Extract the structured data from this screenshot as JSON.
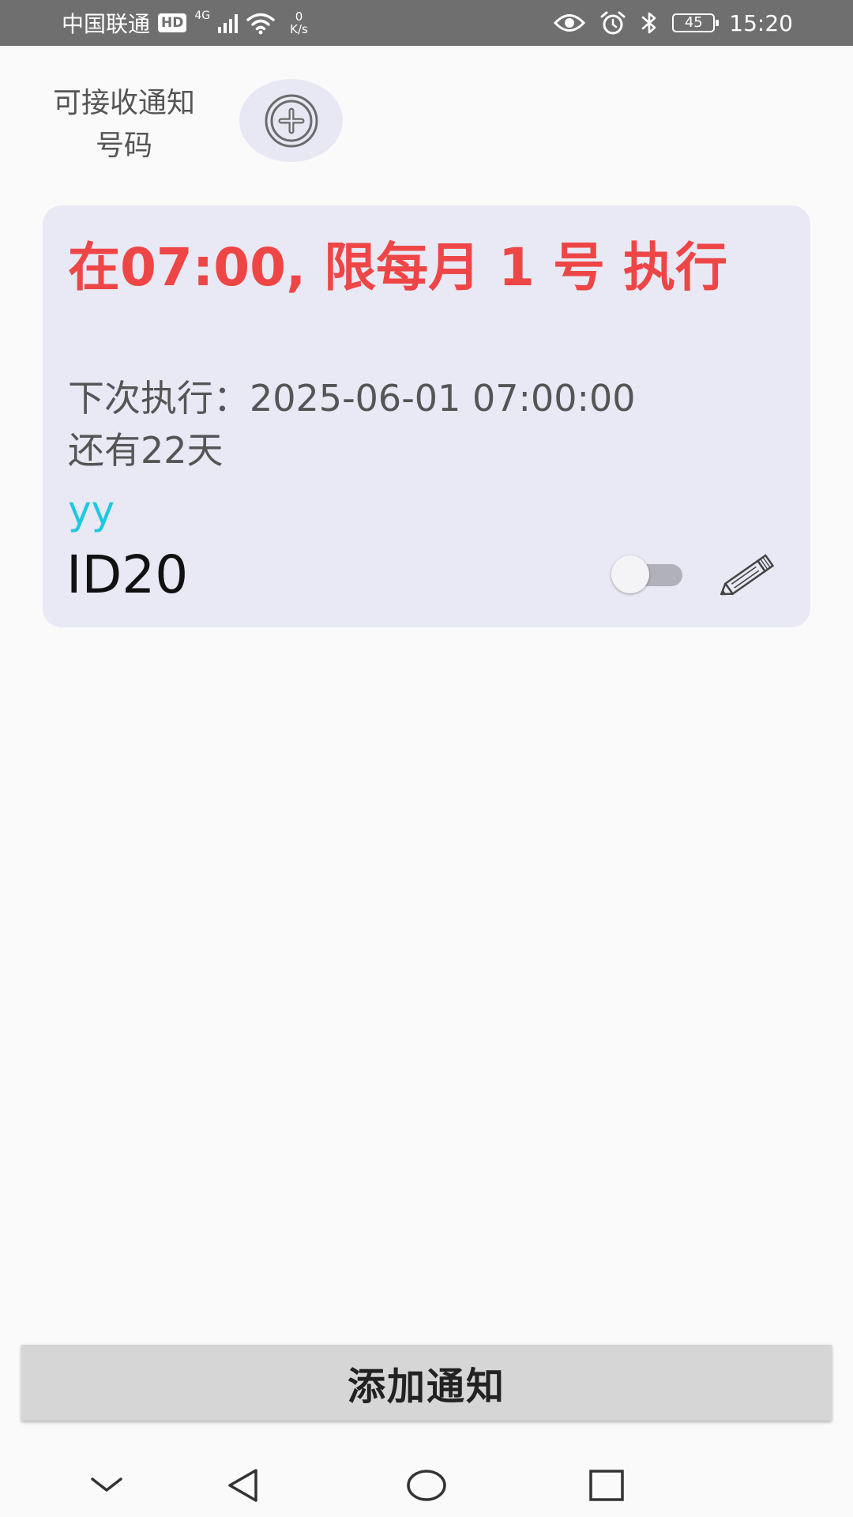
{
  "status_bar": {
    "carrier": "中国联通",
    "hd_badge": "HD",
    "network_type": "4G",
    "speed_value": "0",
    "speed_unit": "K/s",
    "battery_level": "45",
    "time": "15:20",
    "icons": [
      "signal-icon",
      "wifi-icon",
      "eye-icon",
      "alarm-icon",
      "bluetooth-icon",
      "battery-icon"
    ]
  },
  "header": {
    "label_line1": "可接收通知",
    "label_line2": "号码",
    "add_icon": "plus-circle-icon"
  },
  "card": {
    "title": "在07:00, 限每月 1 号 执行",
    "next_run": "下次执行：2025-06-01 07:00:00",
    "remaining": "还有22天",
    "name": "yy",
    "id": "ID20",
    "toggle_on": false,
    "edit_icon": "pencil-icon"
  },
  "bottom_button": {
    "label": "添加通知"
  },
  "nav_bar": {
    "icons": [
      "chevron-down-icon",
      "back-icon",
      "home-icon",
      "recents-icon"
    ]
  },
  "colors": {
    "title_red": "#ee4646",
    "name_cyan": "#1ec8e0",
    "card_bg": "#e8e9f5",
    "status_bar_bg": "#6f6f6f"
  }
}
